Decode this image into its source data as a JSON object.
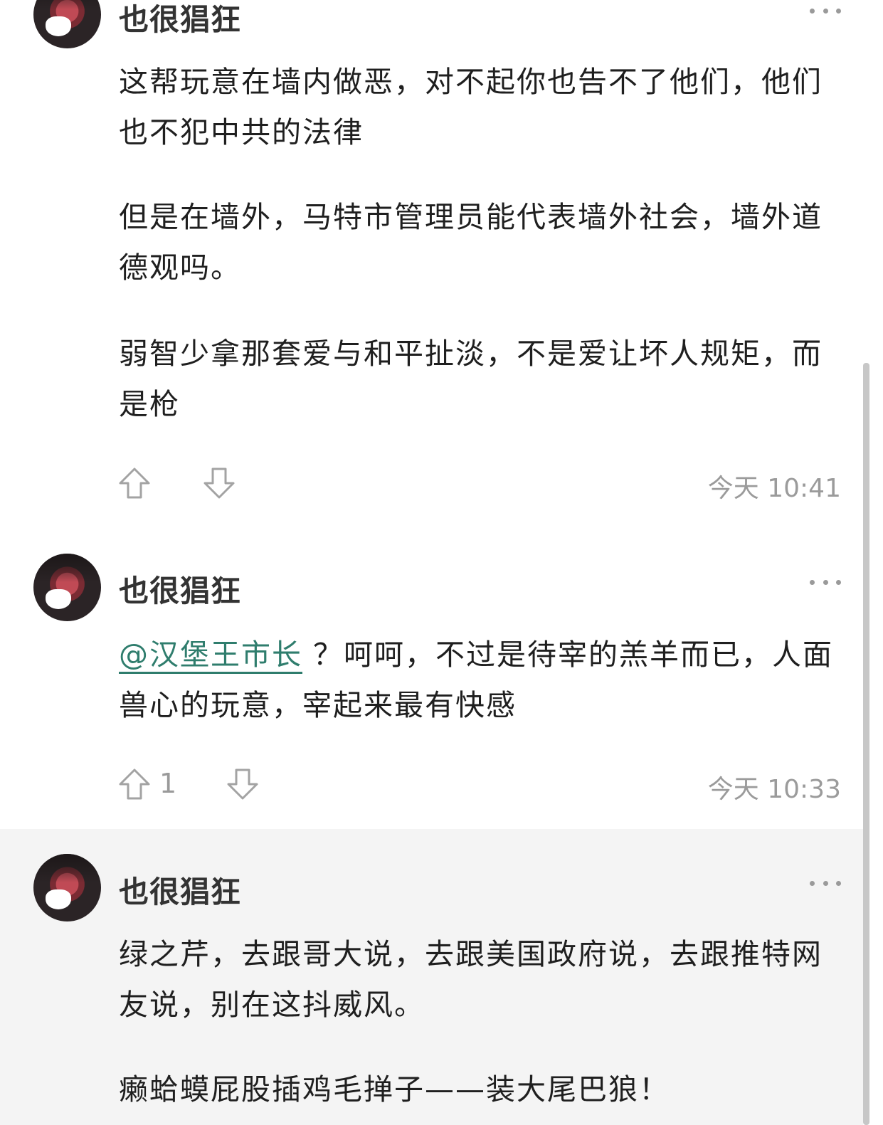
{
  "comments": [
    {
      "username": "也很猖狂",
      "paragraphs": [
        "这帮玩意在墙内做恶，对不起你也告不了他们，他们也不犯中共的法律",
        "但是在墙外，马特市管理员能代表墙外社会，墙外道德观吗。",
        "弱智少拿那套爱与和平扯淡，不是爱让坏人规矩，而是枪"
      ],
      "upvotes": "",
      "time": "今天 10:41"
    },
    {
      "username": "也很猖狂",
      "mention": "@汉堡王市长",
      "text": " ？呵呵，不过是待宰的羔羊而已，人面兽心的玩意，宰起来最有快感",
      "upvotes": "1",
      "time": "今天 10:33"
    },
    {
      "username": "也很猖狂",
      "paragraphs": [
        "绿之芹，去跟哥大说，去跟美国政府说，去跟推特网友说，别在这抖威风。",
        "癞蛤蟆屁股插鸡毛掸子——装大尾巴狼！"
      ]
    }
  ],
  "icons": {
    "upvote": "upvote-arrow-icon",
    "downvote": "downvote-arrow-icon",
    "more": "more-dots-icon"
  },
  "colors": {
    "mention": "#2f7d6d",
    "highlight_bg": "#f4f4f4",
    "meta_text": "#9b9b9b"
  }
}
